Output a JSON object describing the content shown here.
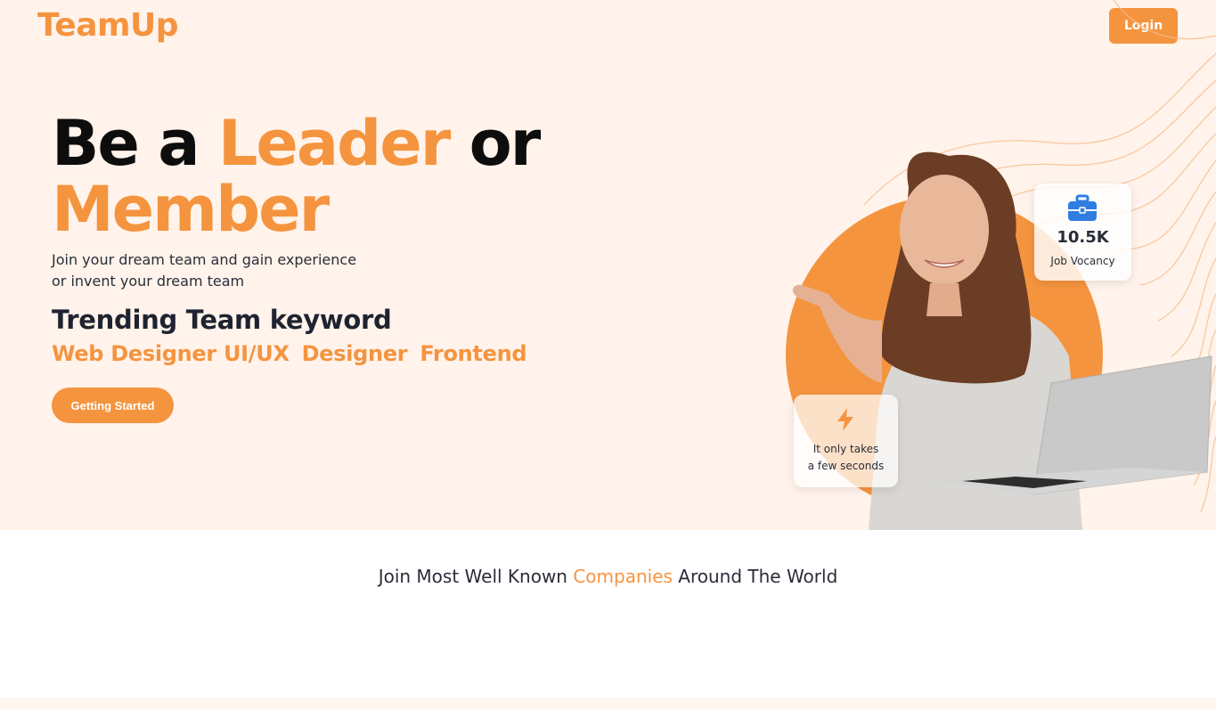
{
  "header": {
    "brand": "TeamUp",
    "login_label": "Login"
  },
  "hero": {
    "headline": {
      "word1": "Be a",
      "word2": "Leader",
      "word3": "or",
      "word4": "Member"
    },
    "subtitle_line1": "Join your dream team and gain experience",
    "subtitle_line2": "or invent your dream team",
    "trending_title": "Trending Team keyword",
    "keywords": [
      "Web Designer UI/UX",
      "Designer",
      "Frontend"
    ],
    "cta_label": "Getting Started",
    "stat_card": {
      "icon": "briefcase-icon",
      "value": "10.5K",
      "label": "Job Vocancy"
    },
    "speed_card": {
      "icon": "lightning-icon",
      "line1": "It only takes",
      "line2": "a few seconds"
    }
  },
  "companies": {
    "text_before": "Join Most Well Known",
    "highlight": "Companies",
    "text_after": "Around The World"
  },
  "colors": {
    "accent": "#f5943f",
    "hero_bg": "#fff3eb",
    "text_dark": "#1f2330",
    "icon_blue": "#2f7de1"
  }
}
